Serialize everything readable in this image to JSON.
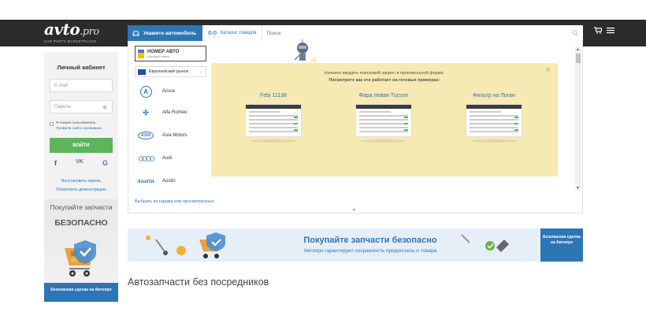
{
  "header": {
    "logo_main": "avto",
    "logo_pro": ".pro",
    "logo_sub": "CAR PARTS MARKETPLACE",
    "tab_car": "Укажите автомобиль",
    "tab_catalog": "Каталог товаров",
    "search_placeholder": "Поиск"
  },
  "sidebar": {
    "title": "Личный кабинет",
    "email_placeholder": "E-mail",
    "password_placeholder": "Пароль",
    "new_user": "Я новый пользователь",
    "rules_link": "Правила сайта принимаю",
    "login_button": "ВОЙТИ",
    "social": [
      "f",
      "VK",
      "G"
    ],
    "restore_password": "Восстановить пароль",
    "view_demo": "Посмотреть демонстрацию",
    "promo_title": "Покупайте запчасти",
    "promo_bold": "БЕЗОПАСНО",
    "promo_footer": "Безопасная сделка на Автопро"
  },
  "selector": {
    "vin_title": "НОМЕР АВТО",
    "vin_sub": "Быстрый поиск",
    "market": "Европейский рынок",
    "brands": [
      "Acura",
      "Alfa Romeo",
      "Asia Motors",
      "Audi",
      "Austin"
    ],
    "brand_logos": [
      "A",
      "✣",
      "ASIA",
      "◯◯◯◯",
      "Austin"
    ],
    "hint_line1": "Начните вводить поисковой запрос в произвольной форме.",
    "hint_line2": "Посмотрите как это работает на готовых примерах:",
    "examples": [
      "Febi 11138",
      "Фара левая Tucson",
      "Фильтр на Логан"
    ],
    "garage_link": "Выбрать из гаража или просмотренных"
  },
  "banner": {
    "title": "Покупайте запчасти безопасно",
    "subtitle": "Автопро гарантирует сохранность предоплаты и товара",
    "tag": "Безопасная сделка на Автопро"
  },
  "page_heading": "Автозапчасти без посредников",
  "colors": {
    "accent": "#2e75b6",
    "topbar": "#2b2b2b",
    "login": "#5bb55a",
    "hint_bg": "#f6e9b1"
  }
}
